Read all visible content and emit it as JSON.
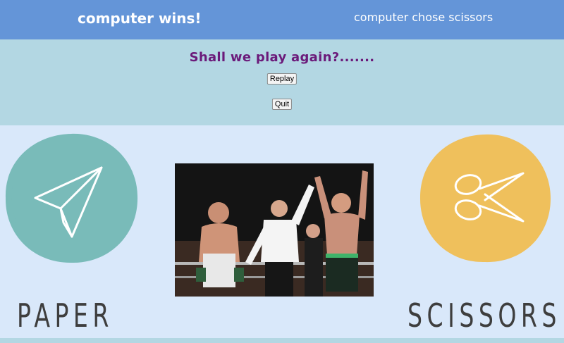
{
  "header": {
    "result": "computer wins!",
    "computer_choice": "computer chose scissors"
  },
  "prompt": {
    "text": "Shall we play again?.......",
    "replay_label": "Replay",
    "quit_label": "Quit"
  },
  "player": {
    "label": "PAPER",
    "icon": "paper-plane-icon",
    "color": "#79bbb9"
  },
  "computer": {
    "label": "SCISSORS",
    "icon": "scissors-icon",
    "color": "#efc05c"
  },
  "photo": {
    "subject": "boxing-winner-photo"
  },
  "colors": {
    "header": "#6495d8",
    "prompt_band": "#b3d7e3",
    "arena": "#d9e8fa",
    "prompt_text": "#6b1a7a"
  }
}
